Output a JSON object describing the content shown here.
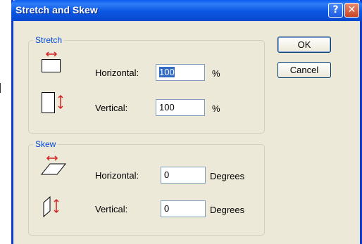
{
  "dialog": {
    "title": "Stretch and Skew",
    "help_glyph": "?",
    "close_glyph": "✕"
  },
  "stretch": {
    "group_label": "Stretch",
    "horizontal_label": "Horizontal:",
    "horizontal_value": "100",
    "horizontal_unit": "%",
    "vertical_label": "Vertical:",
    "vertical_value": "100",
    "vertical_unit": "%"
  },
  "skew": {
    "group_label": "Skew",
    "horizontal_label": "Horizontal:",
    "horizontal_value": "0",
    "horizontal_unit": "Degrees",
    "vertical_label": "Vertical:",
    "vertical_value": "0",
    "vertical_unit": "Degrees"
  },
  "buttons": {
    "ok": "OK",
    "cancel": "Cancel"
  },
  "colors": {
    "titlebar": "#0b56e2",
    "client_bg": "#ece9d8",
    "group_label": "#0046d5",
    "arrow": "#d42020",
    "selection": "#316ac5"
  },
  "icons": {
    "stretch_horizontal": "stretch-horizontal-icon",
    "stretch_vertical": "stretch-vertical-icon",
    "skew_horizontal": "skew-horizontal-icon",
    "skew_vertical": "skew-vertical-icon"
  }
}
